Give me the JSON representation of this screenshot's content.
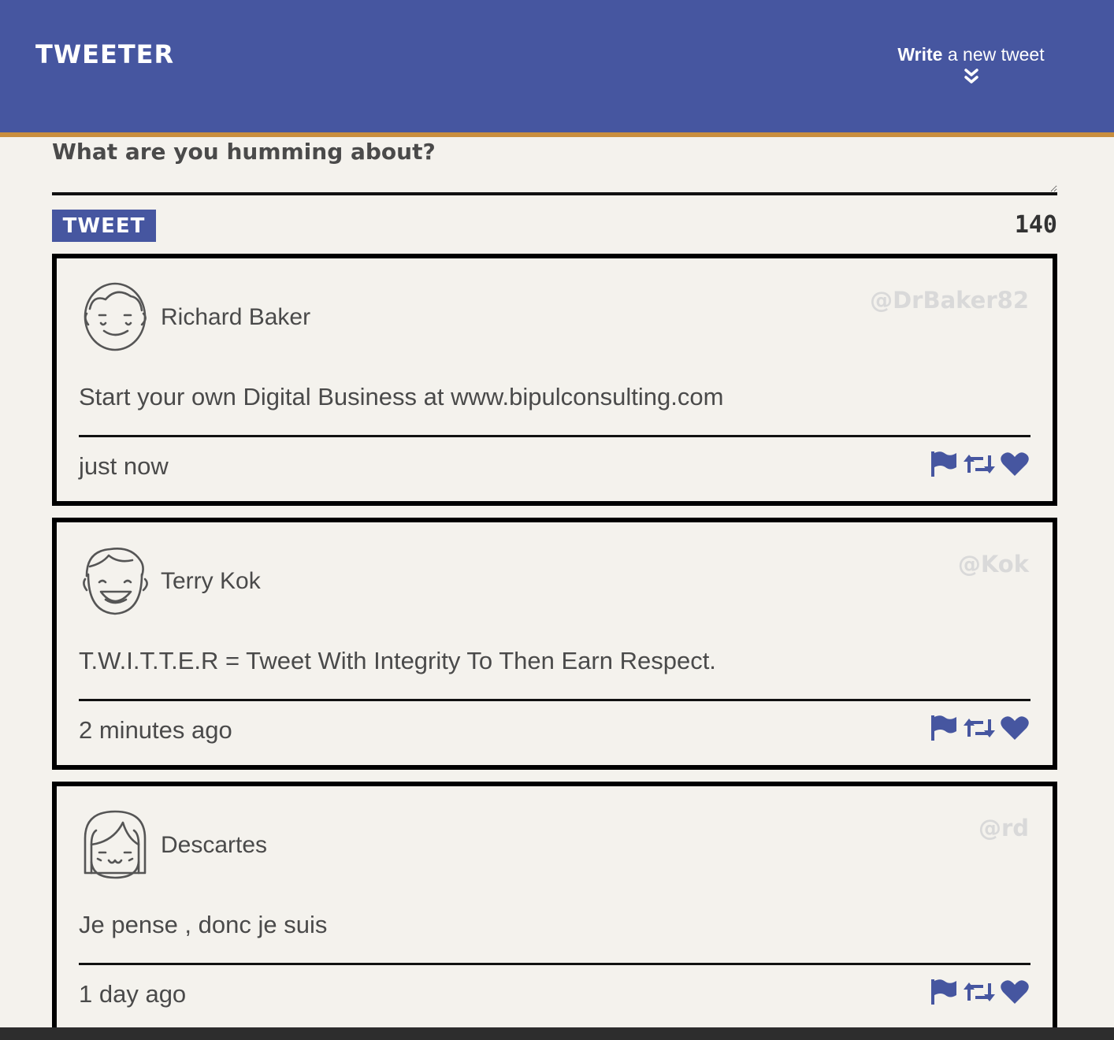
{
  "navbar": {
    "brand": "TWEETER",
    "compose_toggle_bold": "Write",
    "compose_toggle_rest": " a new tweet"
  },
  "compose": {
    "placeholder": "What are you humming about?",
    "button_label": "TWEET",
    "char_count": "140"
  },
  "colors": {
    "brand": "#4656a0",
    "stripe": "#c98e3e",
    "background": "#f4f2ed",
    "handle": "#d9d9d9"
  },
  "tweets": [
    {
      "name": "Richard Baker",
      "handle": "@DrBaker82",
      "text": "Start your own Digital Business at www.bipulconsulting.com",
      "time": "just now",
      "avatar": "smiling-man-avatar-icon"
    },
    {
      "name": "Terry Kok",
      "handle": "@Kok",
      "text": "T.W.I.T.T.E.R = Tweet With Integrity To Then Earn Respect.",
      "time": "2 minutes ago",
      "avatar": "laughing-boy-avatar-icon"
    },
    {
      "name": "Descartes",
      "handle": "@rd",
      "text": "Je pense , donc je suis",
      "time": "1 day ago",
      "avatar": "girl-with-bangs-avatar-icon"
    }
  ]
}
